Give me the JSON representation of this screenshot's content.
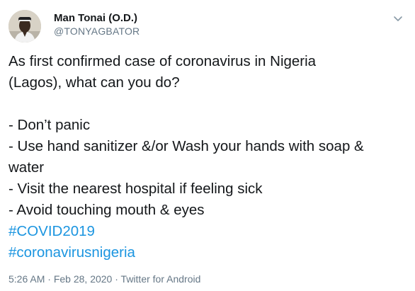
{
  "author": {
    "display_name": "Man Tonai (O.D.)",
    "handle": "@TONYAGBATOR",
    "avatar": "avatar-photo",
    "menu_icon": "chevron-down-icon"
  },
  "tweet": {
    "line1": "As first confirmed case of coronavirus in Nigeria",
    "line2": "(Lagos), what can you do?",
    "bullet1": "- Don’t panic",
    "bullet2a": "- Use hand sanitizer &/or Wash your hands with soap &",
    "bullet2b": "water",
    "bullet3": "- Visit the nearest hospital if feeling sick",
    "bullet4": "- Avoid touching mouth & eyes",
    "hashtags": [
      "#COVID2019",
      "#coronavirusnigeria"
    ]
  },
  "meta": {
    "time": "5:26 AM",
    "separator": " · ",
    "date": "Feb 28, 2020",
    "source": "Twitter for Android"
  },
  "colors": {
    "text": "#14171a",
    "secondary": "#657786",
    "link": "#1b95e0"
  }
}
